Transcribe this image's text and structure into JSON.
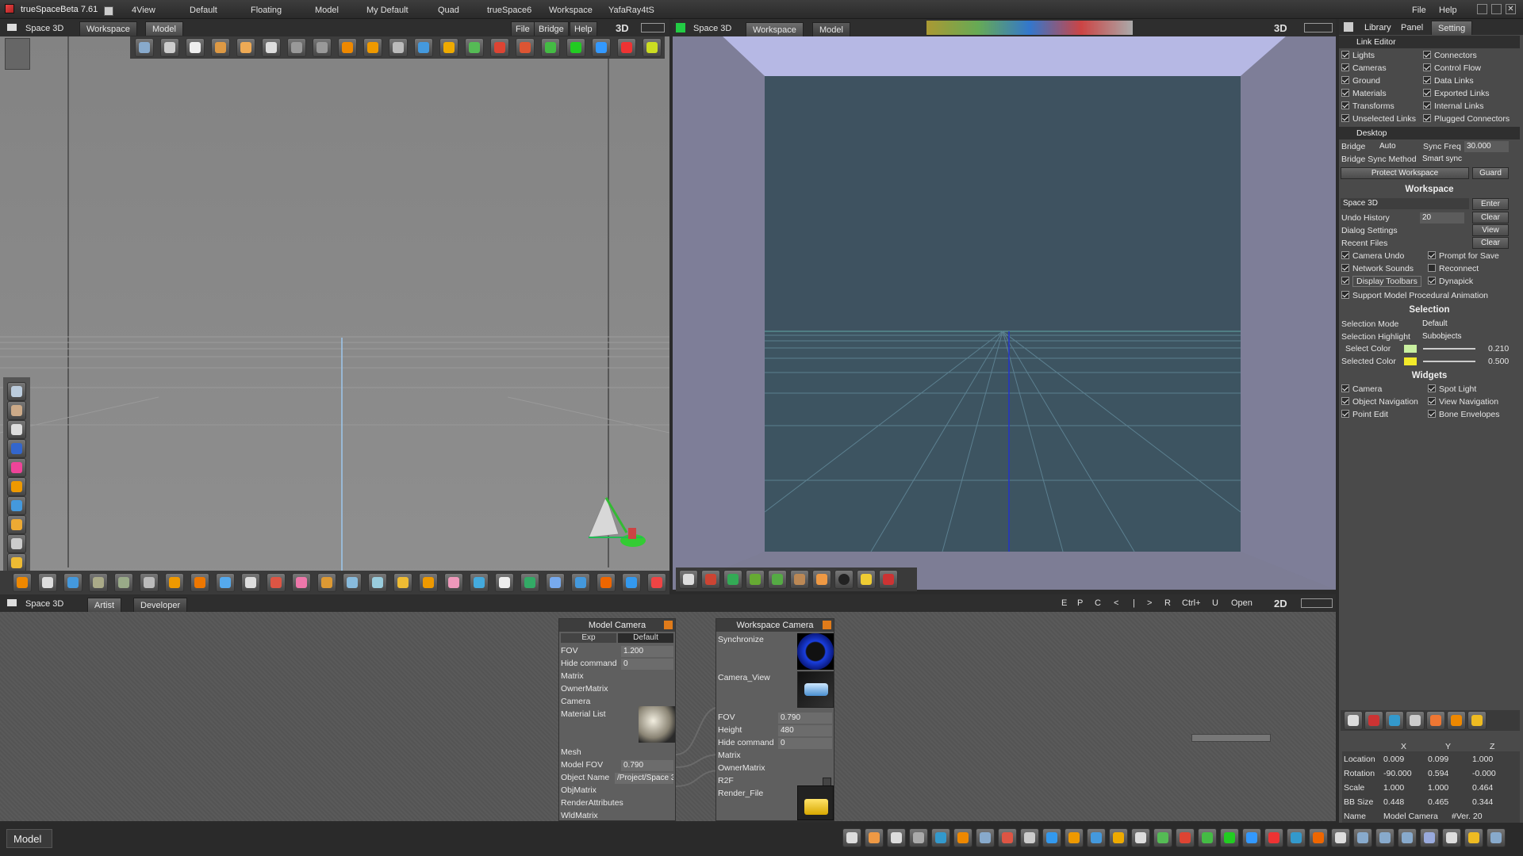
{
  "app": {
    "title": "trueSpaceBeta 7.61"
  },
  "top_menu": [
    "4View",
    "Default",
    "Floating",
    "Model",
    "My Default",
    "Quad",
    "trueSpace6",
    "Workspace",
    "YafaRay4tS"
  ],
  "right_menu": {
    "file": "File",
    "help": "Help"
  },
  "left_view": {
    "tabs": [
      "Space 3D",
      "Workspace",
      "Model"
    ],
    "menu": [
      "File",
      "Bridge",
      "Help"
    ],
    "mode": "3D"
  },
  "right_view": {
    "tabs": [
      "Space 3D",
      "Workspace",
      "Model"
    ],
    "mode": "3D"
  },
  "bottom_view": {
    "tabs": [
      "Space 3D",
      "Artist",
      "Developer"
    ],
    "toolbar": [
      "E",
      "P",
      "C",
      "<",
      "|",
      ">",
      "R",
      "Ctrl+",
      "U",
      "Open"
    ],
    "mode": "2D"
  },
  "side_panel": {
    "tabs": [
      "Library",
      "Panel",
      "Setting"
    ],
    "link_editor": {
      "title": "Link Editor",
      "left": [
        "Lights",
        "Cameras",
        "Ground",
        "Materials",
        "Transforms",
        "Unselected Links"
      ],
      "right": [
        "Connectors",
        "Control Flow",
        "Data Links",
        "Exported Links",
        "Internal Links",
        "Plugged Connectors"
      ]
    },
    "desktop": {
      "title": "Desktop",
      "bridge_label": "Bridge",
      "bridge_value": "Auto",
      "sync_freq_label": "Sync Freq",
      "sync_freq_value": "30.000",
      "sync_method_label": "Bridge Sync Method",
      "sync_method_value": "Smart sync",
      "protect": "Protect Workspace",
      "guard": "Guard"
    },
    "workspace": {
      "title": "Workspace",
      "space_field": "Space 3D",
      "enter": "Enter",
      "undo_label": "Undo History",
      "undo_value": "20",
      "clear": "Clear",
      "dialog_label": "Dialog Settings",
      "view": "View",
      "recent_label": "Recent Files",
      "clear2": "Clear",
      "cb_left": [
        "Camera Undo",
        "Network Sounds",
        "Display Toolbars"
      ],
      "cb_right": [
        "Prompt for Save",
        "Reconnect",
        "Dynapick"
      ],
      "procedural": "Support Model Procedural Animation"
    },
    "selection": {
      "title": "Selection",
      "mode_label": "Selection Mode",
      "mode_value": "Default",
      "highlight_label": "Selection Highlight",
      "highlight_value": "Subobjects",
      "select_color_label": "Select Color",
      "select_color_value": "0.210",
      "selected_color_label": "Selected Color",
      "selected_color_value": "0.500",
      "select_color": "#c9f0a0",
      "selected_color": "#f2ea2a"
    },
    "widgets": {
      "title": "Widgets",
      "left": [
        "Camera",
        "Object Navigation",
        "Point Edit"
      ],
      "right": [
        "Spot Light",
        "View Navigation",
        "Bone Envelopes"
      ]
    },
    "transform": {
      "cols": [
        "X",
        "Y",
        "Z"
      ],
      "rows": [
        {
          "label": "Location",
          "x": "0.009",
          "y": "0.099",
          "z": "1.000"
        },
        {
          "label": "Rotation",
          "x": "-90.000",
          "y": "0.594",
          "z": "-0.000"
        },
        {
          "label": "Scale",
          "x": "1.000",
          "y": "1.000",
          "z": "0.464"
        },
        {
          "label": "BB Size",
          "x": "0.448",
          "y": "0.465",
          "z": "0.344"
        }
      ],
      "name_label": "Name",
      "name_value": "Model Camera",
      "version": "#Ver. 20"
    }
  },
  "nodes": {
    "model_camera": {
      "title": "Model Camera",
      "exp": "Exp",
      "def": "Default",
      "fov_label": "FOV",
      "fov_value": "1.200",
      "hide_label": "Hide command",
      "hide_value": "0",
      "rows": [
        "Matrix",
        "OwnerMatrix",
        "Camera",
        "Material List"
      ],
      "mesh": "Mesh",
      "model_fov_label": "Model FOV",
      "model_fov_value": "0.790",
      "obj_name_label": "Object Name",
      "obj_name_value": "/Project/Space 3",
      "rows2": [
        "ObjMatrix",
        "RenderAttributes",
        "WldMatrix"
      ]
    },
    "workspace_camera": {
      "title": "Workspace Camera",
      "sync": "Synchronize",
      "camview": "Camera_View",
      "fov_label": "FOV",
      "fov_value": "0.790",
      "height_label": "Height",
      "height_value": "480",
      "hide_label": "Hide command",
      "hide_value": "0",
      "rows": [
        "Matrix",
        "OwnerMatrix",
        "R2F"
      ],
      "render": "Render_File"
    }
  },
  "status": {
    "mode": "Model"
  }
}
